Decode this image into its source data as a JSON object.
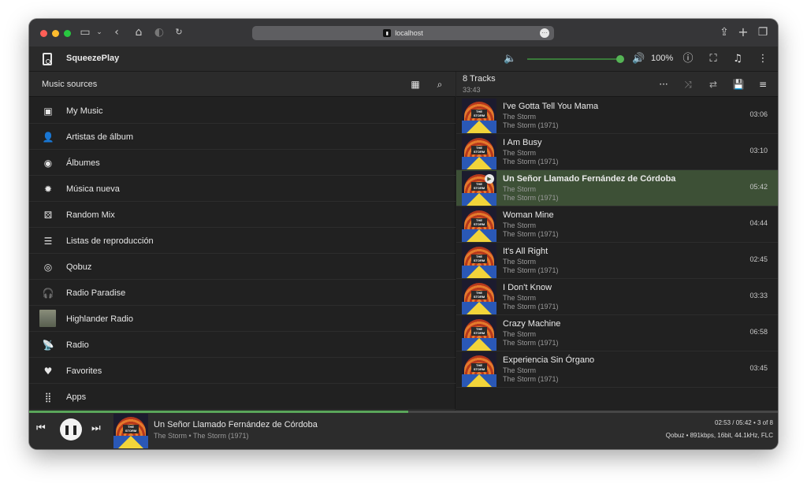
{
  "browser": {
    "url": "localhost",
    "traffic_colors": [
      "#ff5f57",
      "#febc2e",
      "#28c840"
    ]
  },
  "app": {
    "title": "SqueezePlay",
    "volume_percent": 100,
    "volume_label": "100%",
    "accent": "#5aa65a"
  },
  "sources": {
    "header": "Music sources",
    "items": [
      {
        "label": "My Music",
        "icon": "library-music-icon"
      },
      {
        "label": "Artistas de álbum",
        "icon": "album-artist-icon"
      },
      {
        "label": "Álbumes",
        "icon": "album-icon"
      },
      {
        "label": "Música nueva",
        "icon": "new-releases-icon"
      },
      {
        "label": "Random Mix",
        "icon": "dice-icon"
      },
      {
        "label": "Listas de reproducción",
        "icon": "playlist-icon"
      },
      {
        "label": "Qobuz",
        "icon": "qobuz-icon"
      },
      {
        "label": "Radio Paradise",
        "icon": "headphones-icon"
      },
      {
        "label": "Highlander Radio",
        "icon": "station-thumbnail"
      },
      {
        "label": "Radio",
        "icon": "radio-antenna-icon"
      },
      {
        "label": "Favorites",
        "icon": "heart-icon"
      },
      {
        "label": "Apps",
        "icon": "apps-grid-icon"
      }
    ]
  },
  "queue": {
    "count_label": "8 Tracks",
    "duration": "33:43",
    "tracks": [
      {
        "title": "I've Gotta Tell You Mama",
        "artist": "The Storm",
        "album": "The Storm (1971)",
        "duration": "03:06"
      },
      {
        "title": "I Am Busy",
        "artist": "The Storm",
        "album": "The Storm (1971)",
        "duration": "03:10"
      },
      {
        "title": "Un Señor Llamado Fernández de Córdoba",
        "artist": "The Storm",
        "album": "The Storm (1971)",
        "duration": "05:42"
      },
      {
        "title": "Woman Mine",
        "artist": "The Storm",
        "album": "The Storm (1971)",
        "duration": "04:44"
      },
      {
        "title": "It's All Right",
        "artist": "The Storm",
        "album": "The Storm (1971)",
        "duration": "02:45"
      },
      {
        "title": "I Don't Know",
        "artist": "The Storm",
        "album": "The Storm (1971)",
        "duration": "03:33"
      },
      {
        "title": "Crazy Machine",
        "artist": "The Storm",
        "album": "The Storm (1971)",
        "duration": "06:58"
      },
      {
        "title": "Experiencia Sin Órgano",
        "artist": "The Storm",
        "album": "The Storm (1971)",
        "duration": "03:45"
      }
    ],
    "active_index": 2
  },
  "now_playing": {
    "title": "Un Señor Llamado Fernández de Córdoba",
    "subtitle": "The Storm • The Storm (1971)",
    "time_info": "02:53 / 05:42 • 3 of 8",
    "format_info": "Qobuz • 891kbps, 16bit, 44.1kHz, FLC",
    "progress_fraction": 0.506,
    "album_art_text": "THE STORM"
  }
}
